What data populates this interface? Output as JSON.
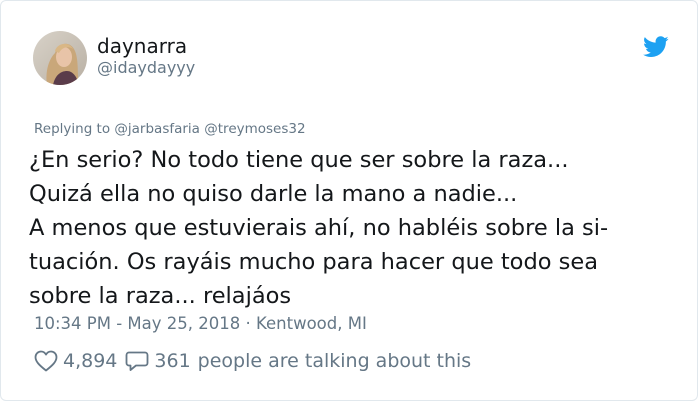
{
  "author": {
    "display_name": "daynarra",
    "handle": "@idaydayyy"
  },
  "reply_context": {
    "prefix": "Replying to",
    "mentions": [
      "@jarbasfaria",
      "@treymoses32"
    ]
  },
  "tweet": {
    "lines": [
      "¿En serio? No todo tiene que ser sobre la raza...",
      "Quizá ella no quiso darle la mano a nadie...",
      "A menos que estuvierais ahí, no habléis sobre la si-",
      "tuación. Os rayáis mucho para hacer que todo sea",
      "sobre la raza... relajáos"
    ]
  },
  "meta": {
    "text": "10:34 PM - May 25, 2018 · Kentwood, MI"
  },
  "actions": {
    "likes": "4,894",
    "replies": "361",
    "talking_text": "people are talking about this"
  },
  "icons": {
    "brand": "twitter-bird-icon",
    "like": "heart-icon",
    "reply": "speech-bubble-icon"
  },
  "colors": {
    "brand": "#1da1f2",
    "text": "#14171a",
    "secondary": "#657786",
    "border": "#e1e8ed"
  }
}
